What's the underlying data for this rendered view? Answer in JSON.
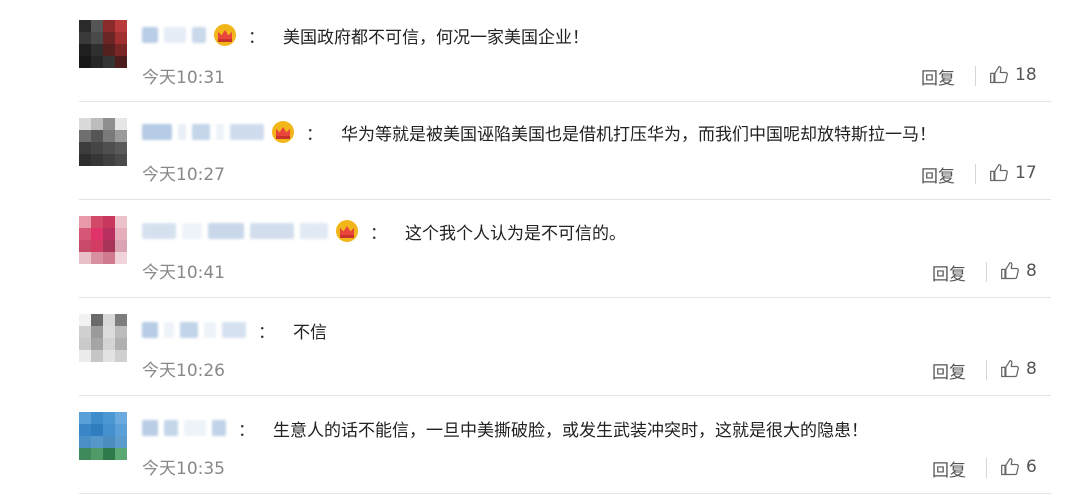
{
  "comments": [
    {
      "text": "美国政府都不可信，何况一家美国企业！",
      "time": "今天10:31",
      "reply": "回复",
      "likes": "18",
      "colon": "："
    },
    {
      "text": "华为等就是被美国诬陷美国也是借机打压华为，而我们中国呢却放特斯拉一马！",
      "time": "今天10:27",
      "reply": "回复",
      "likes": "17",
      "colon": "："
    },
    {
      "text": "这个我个人认为是不可信的。",
      "time": "今天10:41",
      "reply": "回复",
      "likes": "8",
      "colon": "："
    },
    {
      "text": "不信",
      "time": "今天10:26",
      "reply": "回复",
      "likes": "8",
      "colon": "："
    },
    {
      "text": "生意人的话不能信，一旦中美撕破脸，或发生武装冲突时，这就是很大的隐患！",
      "time": "今天10:35",
      "reply": "回复",
      "likes": "6",
      "colon": "："
    }
  ],
  "icons": {
    "like": "thumbs-up-icon",
    "badge": "crown-icon"
  },
  "colors": {
    "time": "#888888",
    "badge": "#f2b51a",
    "divider": "#e4e4e4"
  }
}
